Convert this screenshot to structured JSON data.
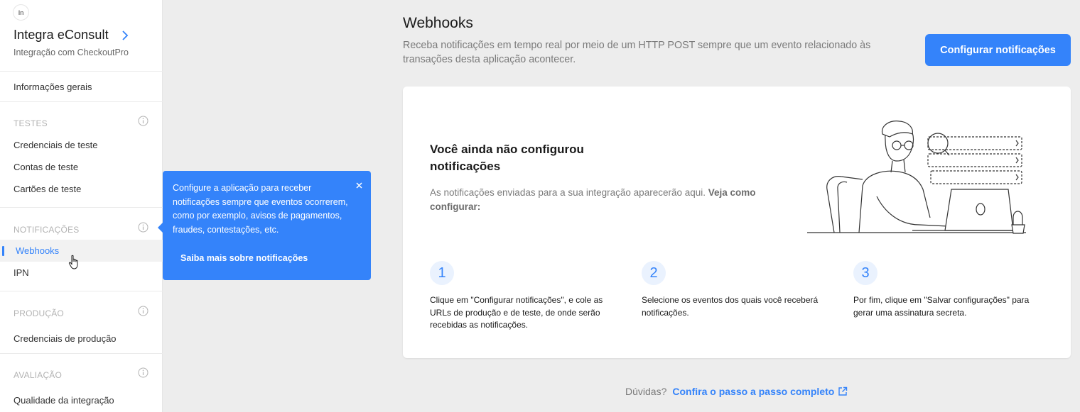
{
  "sidebar": {
    "avatar": "In",
    "app_title": "Integra eConsult",
    "app_subtitle": "Integração com CheckoutPro",
    "overview": "Informações gerais",
    "sections": {
      "tests": {
        "label": "TESTES",
        "items": [
          "Credenciais de teste",
          "Contas de teste",
          "Cartões de teste"
        ]
      },
      "notifications": {
        "label": "NOTIFICAÇÕES",
        "items": [
          "Webhooks",
          "IPN"
        ]
      },
      "production": {
        "label": "PRODUÇÃO",
        "items": [
          "Credenciais de produção"
        ]
      },
      "evaluation": {
        "label": "AVALIAÇÃO",
        "items": [
          "Qualidade da integração"
        ]
      }
    },
    "active_item": "Webhooks"
  },
  "tooltip": {
    "text": "Configure a aplicação para receber notificações sempre que eventos ocorrerem, como por exemplo, avisos de pagamentos, fraudes, contestações, etc.",
    "link": "Saiba mais sobre notificações"
  },
  "main": {
    "title": "Webhooks",
    "description": "Receba notificações em tempo real por meio de um HTTP POST sempre que um evento relacionado às transações desta aplicação acontecer.",
    "configure_button": "Configurar notificações",
    "empty_state": {
      "title": "Você ainda não configurou notificações",
      "description": "As notificações enviadas para a sua integração aparecerão aqui.",
      "description_link": "Veja como configurar:"
    },
    "steps": [
      {
        "number": "1",
        "text": "Clique em \"Configurar notificações\", e cole as URLs de produção e de teste, de onde serão recebidas as notificações."
      },
      {
        "number": "2",
        "text": "Selecione os eventos dos quais você receberá notificações."
      },
      {
        "number": "3",
        "text": "Por fim, clique em \"Salvar configurações\" para gerar uma assinatura secreta."
      }
    ],
    "help": {
      "label": "Dúvidas?",
      "link": "Confira o passo a passo completo"
    }
  },
  "colors": {
    "accent": "#3483fa",
    "background": "#ededed",
    "card": "#ffffff"
  }
}
